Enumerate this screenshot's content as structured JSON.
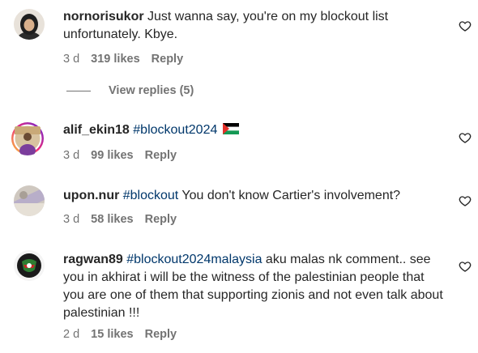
{
  "comments": [
    {
      "username": "nornorisukor",
      "tag": "",
      "text": " Just wanna say, you're on my blockout list unfortunately. Kbye.",
      "age": "3 d",
      "likes": "319 likes",
      "reply": "Reply",
      "view_replies": "View replies (5)"
    },
    {
      "username": "alif_ekin18",
      "tag": " #blockout2024",
      "text": "",
      "age": "3 d",
      "likes": "99 likes",
      "reply": "Reply"
    },
    {
      "username": "upon.nur",
      "tag": " #blockout",
      "text": " You don't know Cartier's involvement?",
      "age": "3 d",
      "likes": "58 likes",
      "reply": "Reply"
    },
    {
      "username": "ragwan89",
      "tag": " #blockout2024malaysia",
      "text": " aku malas nk comment.. see you in akhirat i will be the witness of the palestinian people that you are one of them that supporting zionis and not even talk about palestinian !!!",
      "age": "2 d",
      "likes": "15 likes",
      "reply": "Reply"
    }
  ],
  "icons": {
    "like": "heart-outline-icon",
    "flag": "palestine-flag-emoji"
  },
  "colors": {
    "hashtag": "#00376b",
    "meta": "#737373",
    "text": "#262626",
    "story_ring_start": "#f9ce34",
    "story_ring_end": "#ee2a7b"
  }
}
